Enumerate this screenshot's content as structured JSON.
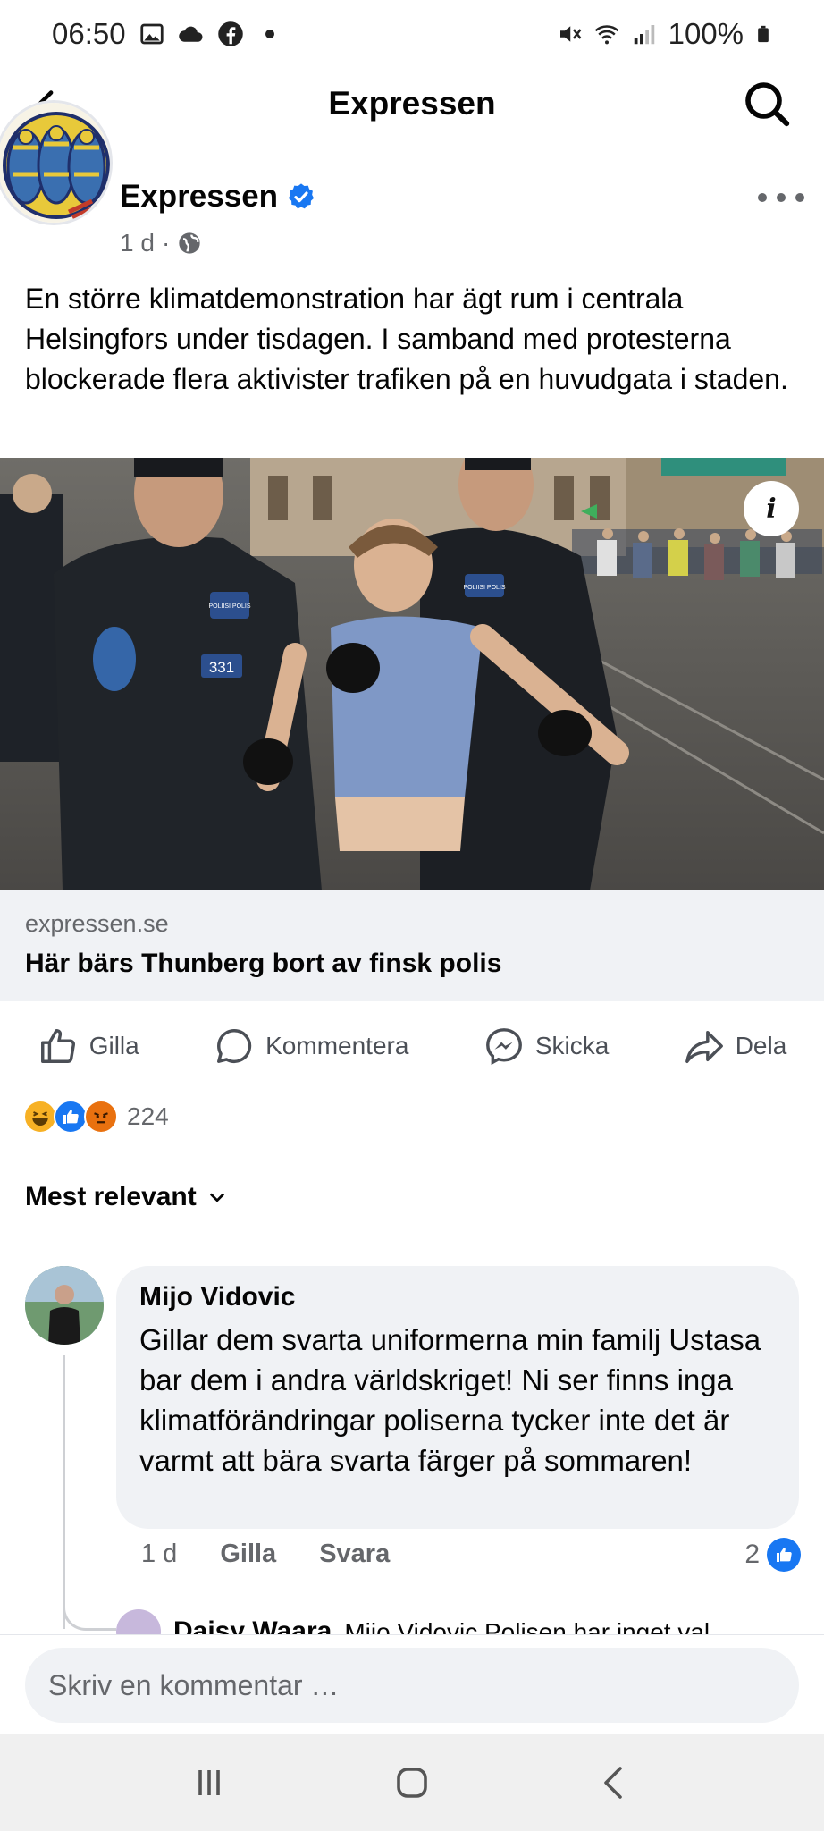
{
  "status_bar": {
    "time": "06:50",
    "battery": "100%"
  },
  "header": {
    "title": "Expressen"
  },
  "post": {
    "page_name": "Expressen",
    "age": "1 d",
    "text": "En större klimatdemonstration har ägt rum i centrala Helsingfors under tisdagen. I samband med protesterna blockerade flera aktivister trafiken på en huvudgata i staden.",
    "link_domain": "expressen.se",
    "link_title": "Här bärs Thunberg bort av finsk polis",
    "image_badges": {
      "badge_left": "331",
      "badge_chest_left": "POLIISI POLIS",
      "badge_chest_right": "POLIISI POLIS"
    }
  },
  "actions": {
    "like": "Gilla",
    "comment": "Kommentera",
    "send": "Skicka",
    "share": "Dela"
  },
  "reactions": {
    "count": "224"
  },
  "sort": {
    "label": "Mest relevant"
  },
  "comment": {
    "author": "Mijo Vidovic",
    "text": "Gillar dem svarta uniformerna min familj Ustasa bar dem i andra världskriget! Ni ser finns inga klimatförändringar poliserna tycker inte det är varmt att bära svarta färger på sommaren!",
    "age": "1 d",
    "like": "Gilla",
    "reply": "Svara",
    "likes": "2"
  },
  "reply": {
    "author": "Daisy Waara",
    "text": "Mijo Vidovic Polisen har inget val"
  },
  "composer": {
    "placeholder": "Skriv en kommentar …"
  },
  "colors": {
    "accent": "#1877f2",
    "secondary_text": "#65676b"
  }
}
